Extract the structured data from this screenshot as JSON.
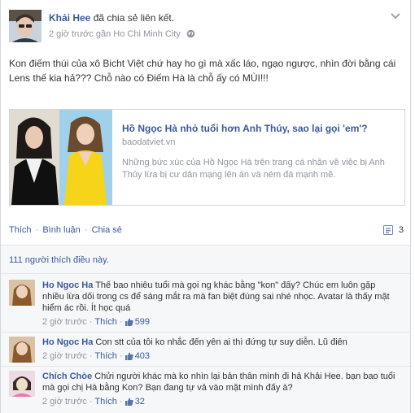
{
  "post": {
    "author": "Khải Hee",
    "action": "đã chia sẻ liên kết.",
    "time": "2 giờ trước",
    "location": "gần Ho Chi Minh City",
    "text": "Kon điếm thúi của xô Bicht Việt chứ hay ho gì mà xấc láo, ngạo ngược, nhìn đời bằng cái Lens thế kia hả??? Chỗ nào có Điếm Hà là chỗ ấy có MÙI!!!"
  },
  "link": {
    "title": "Hồ Ngọc Hà nhỏ tuổi hơn Anh Thúy, sao lại gọi 'em'?",
    "domain": "baodatviet.vn",
    "description": "Những bức xúc của Hồ Ngọc Hà trên trang cá nhân về việc bị Anh Thúy lừa bị cư dân mạng lên án và ném đá mạnh mẽ."
  },
  "actions": {
    "like": "Thích",
    "comment": "Bình luận",
    "share": "Chia sẻ",
    "separator": "·",
    "share_count": "3"
  },
  "likes_text": "111 người thích điều này.",
  "comments": [
    {
      "name": "Ho Ngoc Ha",
      "text": "Thế bao nhiêu tuổi mà gọi ng khác bằng \"kon\" đấy? Chúc em luôn gặp nhiều lừa dối trong cs để sáng mắt ra mà fan biệt đúng sai nhé nhọc. Avatar là thấy mặt hiểm ác rồi. Ít học quá",
      "time": "2 giờ trước",
      "like": "Thích",
      "likes": "599"
    },
    {
      "name": "Ho Ngoc Ha",
      "text": "Con stt của tôi ko nhắc đến yên ai thì đứng tự suy diễn. Lũ điên",
      "time": "2 giờ trước",
      "like": "Thích",
      "likes": "403"
    },
    {
      "name": "Chích Chòe",
      "text": "Chửi người khác mà ko nhìn lại bản thân mình đi hả Khải Hee. bạn bao tuổi mà gọi chị Hà bằng Kon? Bạn đang tự vả vào mặt mình đấy à?",
      "time": "2 giờ trước",
      "like": "Thích",
      "likes": "32"
    }
  ],
  "colors": {
    "link_blue": "#3b5998",
    "meta_gray": "#90949c",
    "ufi_background": "#f6f7f9"
  },
  "icons": {
    "privacy": "globe-icon",
    "menu": "chevron-down-icon",
    "share": "share-count-icon",
    "like": "thumbs-up-icon"
  }
}
